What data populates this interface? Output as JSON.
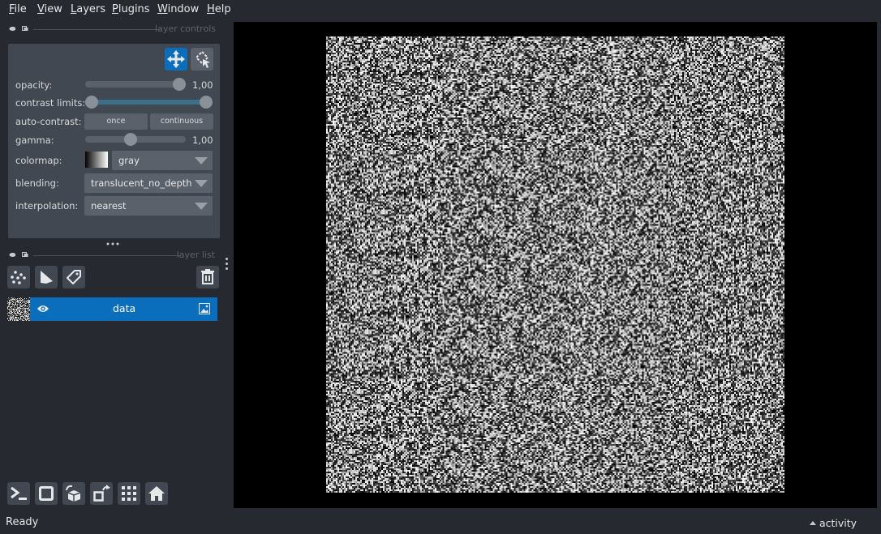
{
  "menubar": {
    "items": [
      {
        "label": "File",
        "accel": "F",
        "rest": "ile"
      },
      {
        "label": "View",
        "accel": "V",
        "rest": "iew"
      },
      {
        "label": "Layers",
        "accel": "L",
        "rest": "ayers"
      },
      {
        "label": "Plugins",
        "accel": "P",
        "rest": "lugins"
      },
      {
        "label": "Window",
        "accel": "W",
        "rest": "indow"
      },
      {
        "label": "Help",
        "accel": "H",
        "rest": "elp"
      }
    ]
  },
  "layer_controls": {
    "section_label": "layer controls",
    "opacity": {
      "label": "opacity:",
      "value": "1,00",
      "fraction": 1.0
    },
    "contrast_limits": {
      "label": "contrast limits:",
      "low_fraction": 0.0,
      "high_fraction": 1.0
    },
    "auto_contrast": {
      "label": "auto-contrast:",
      "once": "once",
      "continuous": "continuous"
    },
    "gamma": {
      "label": "gamma:",
      "value": "1,00",
      "fraction": 0.4
    },
    "colormap": {
      "label": "colormap:",
      "value": "gray"
    },
    "blending": {
      "label": "blending:",
      "value": "translucent_no_depth"
    },
    "interpolation": {
      "label": "interpolation:",
      "value": "nearest"
    },
    "colors": {
      "accent": "#0a6ebd"
    }
  },
  "layer_list": {
    "section_label": "layer list",
    "layers": [
      {
        "name": "data",
        "visible": true,
        "type": "image",
        "selected": true
      }
    ]
  },
  "status_bar": {
    "status": "Ready",
    "activity": "activity"
  }
}
